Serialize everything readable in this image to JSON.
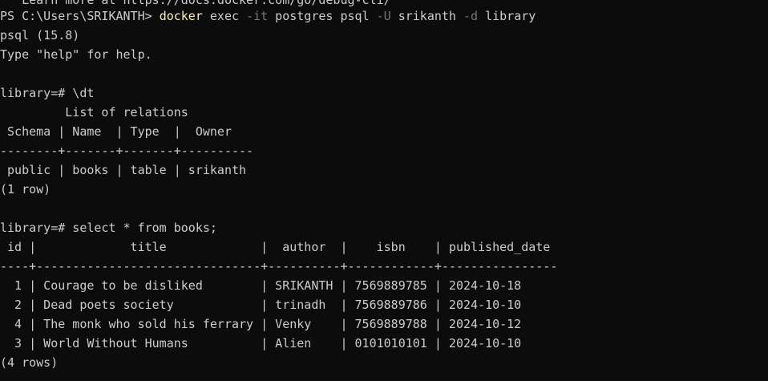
{
  "terminal": {
    "background": "#0c0c0c",
    "foreground": "#cccccc",
    "command_color": "#f9f1a5",
    "flag_color": "#767676",
    "cut_line": "   Learn more at https://docs.docker.com/go/debug-cli/",
    "prompt": "PS C:\\Users\\SRIKANTH> ",
    "command": {
      "program": "docker",
      "parts": [
        " exec ",
        "-it",
        " postgres psql ",
        "-U",
        " srikanth ",
        "-d",
        " library"
      ]
    },
    "lines": [
      "psql (15.8)",
      "Type \"help\" for help.",
      "",
      "library=# \\dt",
      "         List of relations",
      " Schema | Name  | Type  |  Owner",
      "--------+-------+-------+----------",
      " public | books | table | srikanth",
      "(1 row)",
      "",
      "library=# select * from books;",
      " id |             title             |  author  |    isbn    | published_date",
      "----+-------------------------------+----------+------------+----------------",
      "  1 | Courage to be disliked        | SRIKANTH | 7569889785 | 2024-10-18",
      "  2 | Dead poets society            | trinadh  | 7569889786 | 2024-10-10",
      "  4 | The monk who sold his ferrary | Venky    | 7569889788 | 2024-10-12",
      "  3 | World Without Humans          | Alien    | 0101010101 | 2024-10-10",
      "(4 rows)"
    ]
  }
}
